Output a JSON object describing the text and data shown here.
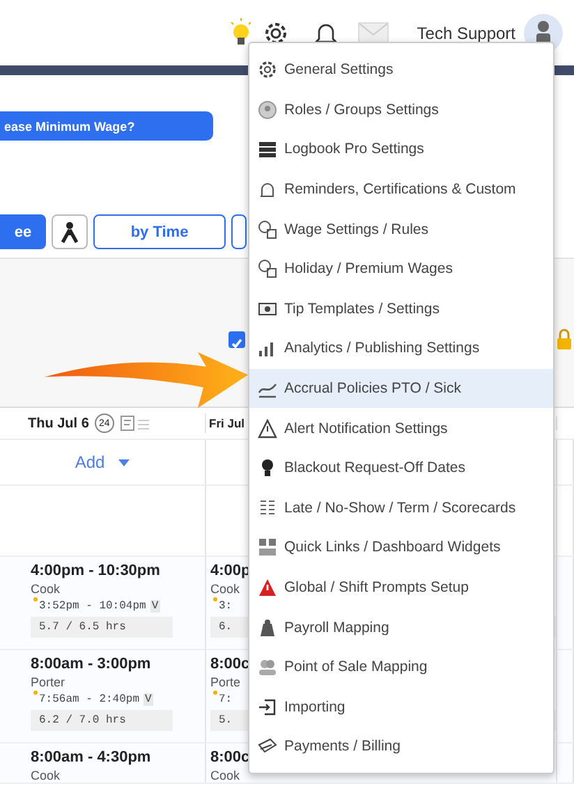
{
  "header": {
    "user": "Tech Support"
  },
  "banner_button": "ease Minimum Wage?",
  "toolbar": [
    {
      "kind": "text",
      "label": "ee",
      "selected": true
    },
    {
      "kind": "icon",
      "selected": false
    },
    {
      "kind": "text",
      "label": "by Time",
      "selected": false
    },
    {
      "kind": "text",
      "selected": false
    }
  ],
  "publish_checkbox": {
    "checked": true
  },
  "days": [
    {
      "label": "Thu Jul 6",
      "count": "24",
      "add": "Add",
      "shifts": [
        {
          "time": "4:00pm - 10:30pm",
          "role": "Cook",
          "punch": "3:52pm - 10:04pm",
          "flag": "V",
          "hours": "5.7 / 6.5 hrs"
        },
        {
          "time": "8:00am - 3:00pm",
          "role": "Porter",
          "punch": "7:56am - 2:40pm",
          "flag": "V",
          "hours": "6.2 / 7.0 hrs"
        },
        {
          "time": "8:00am - 4:30pm",
          "role": "Cook"
        }
      ]
    },
    {
      "label": "Fri Jul",
      "shifts": [
        {
          "time": "4:00p",
          "role": "Cook",
          "punch": "3:",
          "hours": "6."
        },
        {
          "time": "8:00c",
          "role": "Porte",
          "punch": "7:",
          "hours": "5."
        },
        {
          "time": "8:00c",
          "role": "Cook"
        }
      ]
    }
  ],
  "menu": {
    "items": [
      {
        "label": "General Settings",
        "selected": false
      },
      {
        "label": "Roles / Groups Settings",
        "selected": false
      },
      {
        "label": "Logbook Pro Settings",
        "selected": false
      },
      {
        "label": "Reminders, Certifications & Custom",
        "selected": false
      },
      {
        "label": "Wage Settings / Rules",
        "selected": false
      },
      {
        "label": "Holiday / Premium Wages",
        "selected": false
      },
      {
        "label": "Tip Templates / Settings",
        "selected": false
      },
      {
        "label": "Analytics / Publishing Settings",
        "selected": false
      },
      {
        "label": "Accrual Policies PTO / Sick",
        "selected": true
      },
      {
        "label": "Alert Notification Settings",
        "selected": false
      },
      {
        "label": "Blackout Request-Off Dates",
        "selected": false
      },
      {
        "label": "Late / No-Show / Term / Scorecards",
        "selected": false
      },
      {
        "label": "Quick Links / Dashboard Widgets",
        "selected": false
      },
      {
        "label": "Global / Shift Prompts Setup",
        "selected": false
      },
      {
        "label": "Payroll Mapping",
        "selected": false
      },
      {
        "label": "Point of Sale Mapping",
        "selected": false
      },
      {
        "label": "Importing",
        "selected": false
      },
      {
        "label": "Payments / Billing",
        "selected": false
      }
    ]
  }
}
